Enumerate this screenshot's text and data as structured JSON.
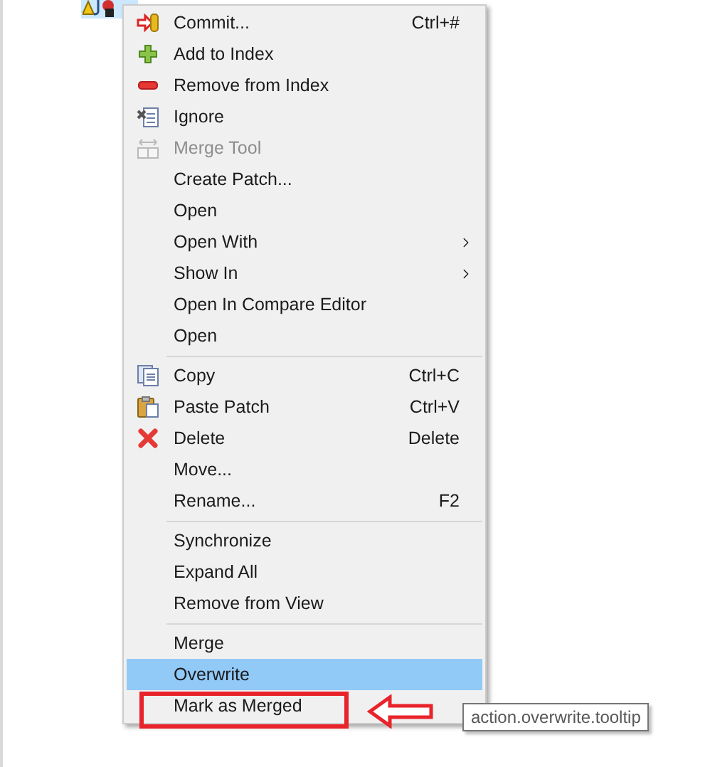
{
  "menu": {
    "items": [
      {
        "kind": "item",
        "label": "Commit...",
        "shortcut": "Ctrl+#",
        "disabled": false,
        "selected": false,
        "submenu": false
      },
      {
        "kind": "item",
        "label": "Add to Index",
        "disabled": false,
        "selected": false,
        "submenu": false
      },
      {
        "kind": "item",
        "label": "Remove from Index",
        "disabled": false,
        "selected": false,
        "submenu": false
      },
      {
        "kind": "item",
        "label": "Ignore",
        "disabled": false,
        "selected": false,
        "submenu": false
      },
      {
        "kind": "item",
        "label": "Merge Tool",
        "disabled": true,
        "selected": false,
        "submenu": false
      },
      {
        "kind": "item",
        "label": "Create Patch...",
        "disabled": false,
        "selected": false,
        "submenu": false
      },
      {
        "kind": "item",
        "label": "Open",
        "disabled": false,
        "selected": false,
        "submenu": false
      },
      {
        "kind": "item",
        "label": "Open With",
        "disabled": false,
        "selected": false,
        "submenu": true
      },
      {
        "kind": "item",
        "label": "Show In",
        "disabled": false,
        "selected": false,
        "submenu": true
      },
      {
        "kind": "item",
        "label": "Open In Compare Editor",
        "disabled": false,
        "selected": false,
        "submenu": false
      },
      {
        "kind": "item",
        "label": "Open",
        "disabled": false,
        "selected": false,
        "submenu": false
      },
      {
        "kind": "separator"
      },
      {
        "kind": "item",
        "label": "Copy",
        "shortcut": "Ctrl+C",
        "disabled": false,
        "selected": false,
        "submenu": false
      },
      {
        "kind": "item",
        "label": "Paste Patch",
        "shortcut": "Ctrl+V",
        "disabled": false,
        "selected": false,
        "submenu": false
      },
      {
        "kind": "item",
        "label": "Delete",
        "shortcut": "Delete",
        "disabled": false,
        "selected": false,
        "submenu": false
      },
      {
        "kind": "item",
        "label": "Move...",
        "disabled": false,
        "selected": false,
        "submenu": false
      },
      {
        "kind": "item",
        "label": "Rename...",
        "shortcut": "F2",
        "disabled": false,
        "selected": false,
        "submenu": false
      },
      {
        "kind": "separator"
      },
      {
        "kind": "item",
        "label": "Synchronize",
        "disabled": false,
        "selected": false,
        "submenu": false
      },
      {
        "kind": "item",
        "label": "Expand All",
        "disabled": false,
        "selected": false,
        "submenu": false
      },
      {
        "kind": "item",
        "label": "Remove from View",
        "disabled": false,
        "selected": false,
        "submenu": false
      },
      {
        "kind": "separator"
      },
      {
        "kind": "item",
        "label": "Merge",
        "disabled": false,
        "selected": false,
        "submenu": false
      },
      {
        "kind": "item",
        "label": "Overwrite",
        "disabled": false,
        "selected": true,
        "submenu": false
      },
      {
        "kind": "item",
        "label": "Mark as Merged",
        "disabled": false,
        "selected": false,
        "submenu": false
      }
    ]
  },
  "tooltip": {
    "text": "action.overwrite.tooltip"
  }
}
